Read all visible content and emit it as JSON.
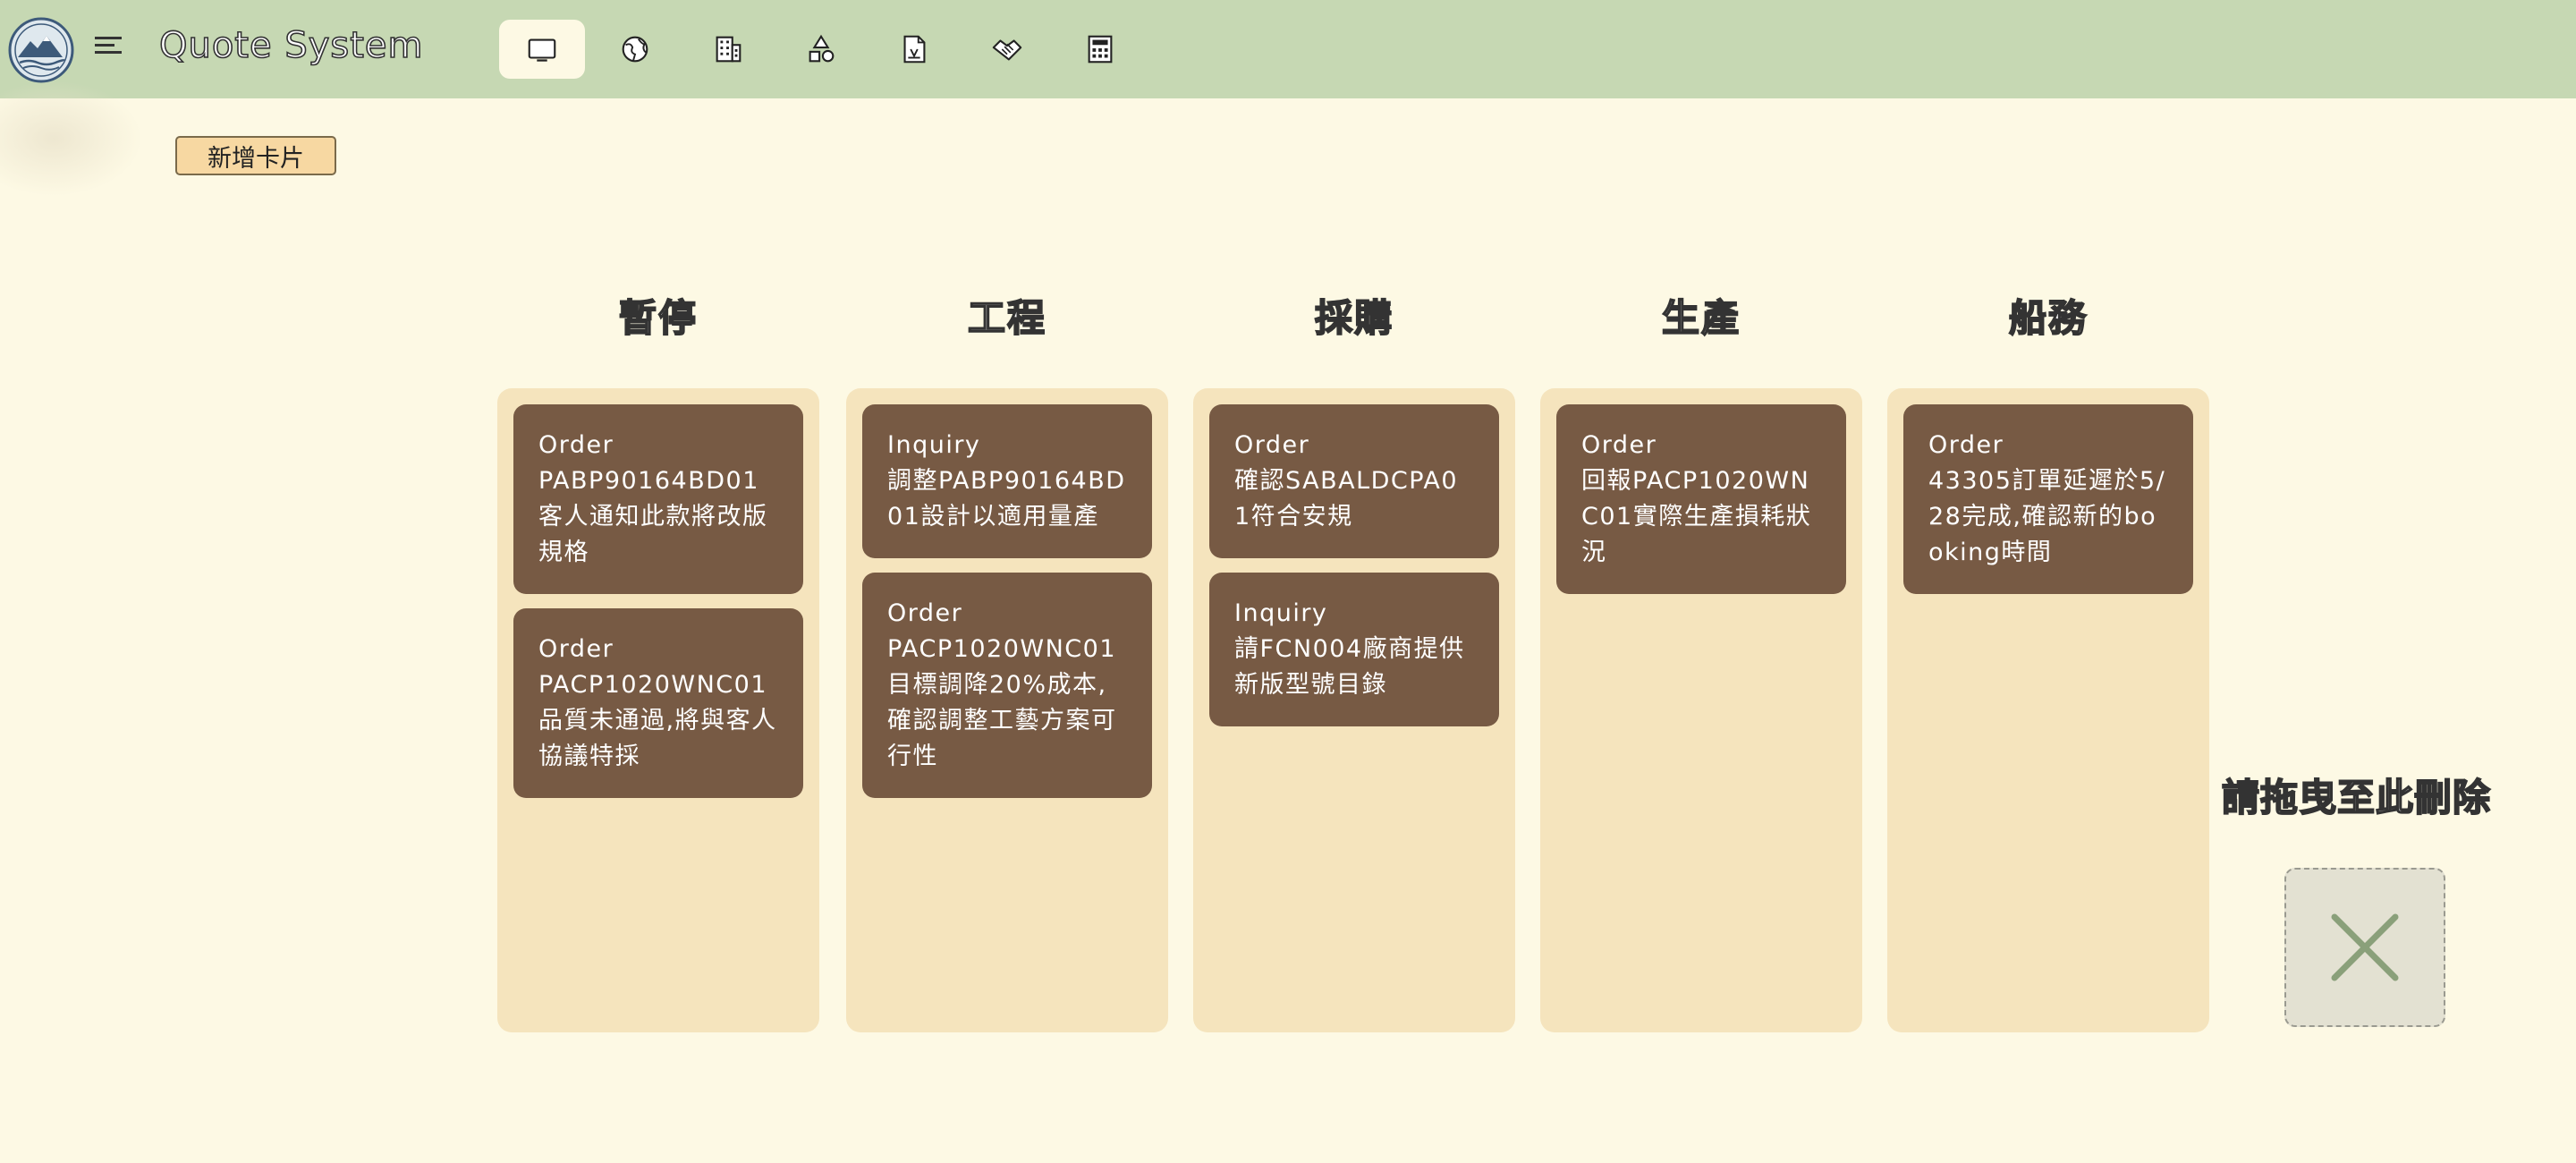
{
  "app": {
    "title": "Quote System"
  },
  "nav": [
    {
      "icon": "monitor-icon",
      "active": true
    },
    {
      "icon": "globe-icon",
      "active": false
    },
    {
      "icon": "building-icon",
      "active": false
    },
    {
      "icon": "shapes-icon",
      "active": false
    },
    {
      "icon": "document-icon",
      "active": false
    },
    {
      "icon": "handshake-icon",
      "active": false
    },
    {
      "icon": "calculator-icon",
      "active": false
    }
  ],
  "toolbar": {
    "add_card_label": "新增卡片"
  },
  "columns": [
    {
      "title": "暫停",
      "cards": [
        {
          "type": "Order",
          "text": "PABP90164BD01客人通知此款將改版規格"
        },
        {
          "type": "Order",
          "text": "PACP1020WNC01品質未通過,將與客人協議特採"
        }
      ]
    },
    {
      "title": "工程",
      "cards": [
        {
          "type": "Inquiry",
          "text": "調整PABP90164BD01設計以適用量產"
        },
        {
          "type": "Order",
          "text": "PACP1020WNC01目標調降20%成本,確認調整工藝方案可行性"
        }
      ]
    },
    {
      "title": "採購",
      "cards": [
        {
          "type": "Order",
          "text": "確認SABALDCPA01符合安規"
        },
        {
          "type": "Inquiry",
          "text": "請FCN004廠商提供新版型號目錄"
        }
      ]
    },
    {
      "title": "生產",
      "cards": [
        {
          "type": "Order",
          "text": "回報PACP1020WNC01實際生產損耗狀況"
        }
      ]
    },
    {
      "title": "船務",
      "cards": [
        {
          "type": "Order",
          "text": "43305訂單延遲於5/28完成,確認新的booking時間"
        }
      ]
    }
  ],
  "trash": {
    "label": "請拖曳至此刪除"
  },
  "colors": {
    "topbar": "#c6d8b3",
    "background": "#fdf9e4",
    "column": "#f5e4bd",
    "card": "#775a44",
    "button": "#f7d8a2",
    "delete_x": "#8aa07a"
  }
}
